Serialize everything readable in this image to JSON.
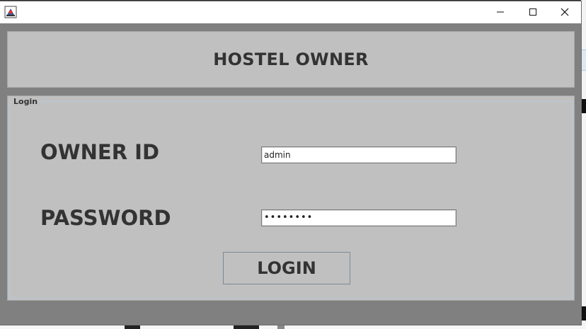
{
  "window": {
    "controls": {
      "minimize": "minimize",
      "maximize": "maximize",
      "close": "close"
    }
  },
  "header": {
    "title": "HOSTEL OWNER"
  },
  "login_panel": {
    "group_title": "Login",
    "owner_id_label": "OWNER ID",
    "owner_id_value": "admin",
    "password_label": "PASSWORD",
    "password_value": "••••••••",
    "login_button": "LOGIN"
  },
  "colors": {
    "window_bg": "#808080",
    "panel_bg": "#c0c0c0",
    "text": "#333333"
  }
}
